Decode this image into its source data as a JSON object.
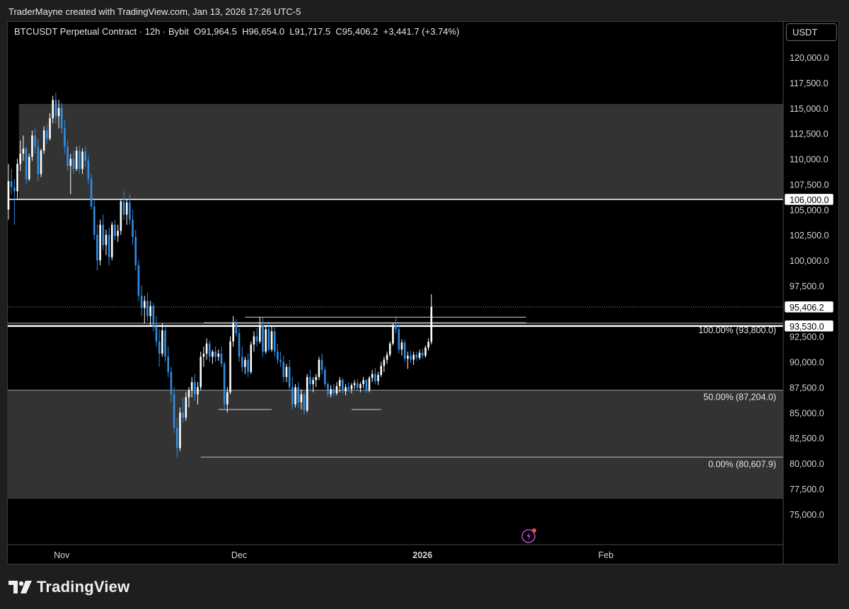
{
  "credit": "TraderMayne created with TradingView.com, Jan 13, 2026 17:26 UTC-5",
  "symbol": {
    "name": "BTCUSDT Perpetual Contract · 12h · Bybit",
    "open_label": "O",
    "open": "91,964.5",
    "high_label": "H",
    "high": "96,654.0",
    "low_label": "L",
    "low": "91,717.5",
    "close_label": "C",
    "close": "95,406.2",
    "change": "+3,441.7 (+3.74%)"
  },
  "currency": "USDT",
  "brand": "TradingView",
  "colors": {
    "background": "#000000",
    "zone": "#333333",
    "up_candle": "#ffffff",
    "down_candle": "#2f8de4",
    "line": "#ffffff"
  },
  "chart_data": {
    "type": "candlestick",
    "price_axis": {
      "ylim": [
        73000,
        122300
      ],
      "ticks": [
        120000,
        117500,
        115000,
        112500,
        110000,
        107500,
        105000,
        102500,
        100000,
        97500,
        92500,
        90000,
        87500,
        85000,
        82500,
        80000,
        77500,
        75000
      ],
      "tick_labels": [
        "120,000.0",
        "117,500.0",
        "115,000.0",
        "112,500.0",
        "110,000.0",
        "107,500.0",
        "105,000.0",
        "102,500.0",
        "100,000.0",
        "97,500.0",
        "92,500.0",
        "90,000.0",
        "87,500.0",
        "85,000.0",
        "82,500.0",
        "80,000.0",
        "77,500.0",
        "75,000.0"
      ]
    },
    "time_axis": {
      "labels": [
        {
          "text": "Nov",
          "bar": 18
        },
        {
          "text": "Dec",
          "bar": 78
        },
        {
          "text": "2026",
          "bar": 140,
          "bold": true
        },
        {
          "text": "Feb",
          "bar": 202
        }
      ]
    },
    "price_labels": [
      {
        "value": 106000,
        "text": "106,000.0"
      },
      {
        "value": 95406.2,
        "text": "95,406.2"
      },
      {
        "value": 93530,
        "text": "93,530.0"
      }
    ],
    "zones": [
      {
        "from": 106000,
        "to": 115400,
        "start_bar": 4
      },
      {
        "from": 76500,
        "to": 87200,
        "start_bar": 0
      }
    ],
    "horizontal_lines": [
      {
        "value": 106000,
        "label": null
      },
      {
        "value": 93530,
        "label": null
      }
    ],
    "fib_levels": [
      {
        "value": 93800,
        "text": "100.00% (93,800.0)"
      },
      {
        "value": 87204,
        "text": "50.00% (87,204.0)"
      },
      {
        "value": 80607.9,
        "text": "0.00% (80,607.9)"
      }
    ],
    "range_marks": [
      {
        "value": 94400,
        "from_bar": 80,
        "to_bar": 175
      },
      {
        "value": 93850,
        "from_bar": 66,
        "to_bar": 175
      },
      {
        "value": 85300,
        "from_bar": 71,
        "to_bar": 89
      },
      {
        "value": 85300,
        "from_bar": 116,
        "to_bar": 126
      }
    ],
    "last_price": 95406.2,
    "candles": [
      [
        105000,
        109500,
        104000,
        107800
      ],
      [
        107800,
        109000,
        106500,
        107200
      ],
      [
        107200,
        108000,
        103500,
        106800
      ],
      [
        106800,
        110000,
        106000,
        109500
      ],
      [
        109500,
        111800,
        108800,
        110500
      ],
      [
        110500,
        112300,
        109800,
        111000
      ],
      [
        111000,
        111200,
        107500,
        108000
      ],
      [
        108000,
        110500,
        107800,
        110200
      ],
      [
        110200,
        112800,
        109800,
        112300
      ],
      [
        112300,
        113000,
        110500,
        111200
      ],
      [
        111200,
        112000,
        107800,
        108500
      ],
      [
        108500,
        111000,
        108200,
        110800
      ],
      [
        110800,
        113200,
        110500,
        112800
      ],
      [
        112800,
        113400,
        111500,
        112000
      ],
      [
        112000,
        114500,
        111800,
        114000
      ],
      [
        114000,
        116200,
        113500,
        115800
      ],
      [
        115800,
        116500,
        113500,
        114200
      ],
      [
        114200,
        115800,
        113000,
        115000
      ],
      [
        115000,
        115500,
        112500,
        113000
      ],
      [
        113000,
        113800,
        110500,
        111200
      ],
      [
        111200,
        111800,
        108800,
        109300
      ],
      [
        109300,
        110500,
        106500,
        110000
      ],
      [
        110000,
        110800,
        108500,
        109000
      ],
      [
        109000,
        111200,
        108800,
        110800
      ],
      [
        110800,
        111300,
        108500,
        109000
      ],
      [
        109000,
        111000,
        108500,
        110700
      ],
      [
        110700,
        111200,
        109200,
        109800
      ],
      [
        109800,
        110300,
        107500,
        108000
      ],
      [
        108000,
        108500,
        105000,
        105300
      ],
      [
        105300,
        106000,
        102000,
        102500
      ],
      [
        102500,
        103500,
        99000,
        100000
      ],
      [
        100000,
        104000,
        99500,
        103500
      ],
      [
        103500,
        104500,
        101000,
        101500
      ],
      [
        101500,
        103000,
        100500,
        102500
      ],
      [
        102500,
        103200,
        99500,
        100300
      ],
      [
        100300,
        103800,
        100000,
        103500
      ],
      [
        103500,
        104000,
        102000,
        102400
      ],
      [
        102400,
        103500,
        101800,
        102900
      ],
      [
        102900,
        106000,
        102500,
        105800
      ],
      [
        105800,
        106800,
        104000,
        104500
      ],
      [
        104500,
        106000,
        103500,
        105700
      ],
      [
        105700,
        106500,
        103500,
        104000
      ],
      [
        104000,
        105000,
        101500,
        102300
      ],
      [
        102300,
        103000,
        99000,
        99500
      ],
      [
        99500,
        100000,
        96000,
        96500
      ],
      [
        96500,
        97500,
        94500,
        95300
      ],
      [
        95300,
        96500,
        93800,
        96000
      ],
      [
        96000,
        96800,
        94000,
        94500
      ],
      [
        94500,
        96000,
        93500,
        95500
      ],
      [
        95500,
        95800,
        93000,
        93500
      ],
      [
        93500,
        94500,
        91500,
        92000
      ],
      [
        92000,
        93200,
        89500,
        90800
      ],
      [
        90800,
        93800,
        90500,
        93100
      ],
      [
        93100,
        93500,
        90000,
        90500
      ],
      [
        90500,
        91500,
        88500,
        89000
      ],
      [
        89000,
        89500,
        86000,
        86800
      ],
      [
        86800,
        87500,
        83000,
        83500
      ],
      [
        83500,
        84500,
        80600,
        81500
      ],
      [
        81500,
        85500,
        81200,
        85000
      ],
      [
        85000,
        86500,
        84000,
        84500
      ],
      [
        84500,
        87000,
        84200,
        86500
      ],
      [
        86500,
        87500,
        85500,
        87200
      ],
      [
        87200,
        88500,
        86500,
        88000
      ],
      [
        88000,
        88800,
        86200,
        86800
      ],
      [
        86800,
        88000,
        85800,
        87500
      ],
      [
        87500,
        91000,
        87200,
        90500
      ],
      [
        90500,
        91500,
        89500,
        90800
      ],
      [
        90800,
        92300,
        90200,
        91800
      ],
      [
        91800,
        92100,
        90000,
        90500
      ],
      [
        90500,
        91200,
        89800,
        91000
      ],
      [
        91000,
        91500,
        90000,
        90500
      ],
      [
        90500,
        91200,
        90100,
        90800
      ],
      [
        90800,
        91500,
        89500,
        89800
      ],
      [
        89800,
        90000,
        85300,
        85800
      ],
      [
        85800,
        87500,
        85000,
        87000
      ],
      [
        87000,
        92500,
        86800,
        92000
      ],
      [
        92000,
        94500,
        91500,
        93800
      ],
      [
        93800,
        94200,
        92500,
        92800
      ],
      [
        92800,
        93300,
        90000,
        90500
      ],
      [
        90500,
        91500,
        89000,
        89500
      ],
      [
        89500,
        90500,
        88800,
        90200
      ],
      [
        90200,
        90800,
        88500,
        89000
      ],
      [
        89000,
        92000,
        88800,
        91700
      ],
      [
        91700,
        93000,
        91000,
        92500
      ],
      [
        92500,
        93300,
        91500,
        92000
      ],
      [
        92000,
        94400,
        91800,
        93600
      ],
      [
        93600,
        94400,
        90500,
        91000
      ],
      [
        91000,
        93600,
        90800,
        93200
      ],
      [
        93200,
        93800,
        91000,
        91200
      ],
      [
        91200,
        93500,
        91000,
        93000
      ],
      [
        93000,
        93400,
        90500,
        91000
      ],
      [
        91000,
        91800,
        89800,
        90200
      ],
      [
        90200,
        91000,
        89500,
        90000
      ],
      [
        90000,
        90600,
        88000,
        88500
      ],
      [
        88500,
        89800,
        88000,
        89500
      ],
      [
        89500,
        90200,
        87200,
        87500
      ],
      [
        87500,
        88500,
        85300,
        85800
      ],
      [
        85800,
        87800,
        85500,
        87500
      ],
      [
        87500,
        88000,
        85500,
        86000
      ],
      [
        86000,
        87300,
        85300,
        86800
      ],
      [
        86800,
        87000,
        84800,
        85200
      ],
      [
        85200,
        88800,
        85000,
        88500
      ],
      [
        88500,
        89200,
        87200,
        87800
      ],
      [
        87800,
        88500,
        87000,
        88200
      ],
      [
        88200,
        88800,
        87500,
        88500
      ],
      [
        88500,
        90500,
        88200,
        90200
      ],
      [
        90200,
        90800,
        88800,
        89200
      ],
      [
        89200,
        89500,
        87500,
        87800
      ],
      [
        87800,
        88000,
        86500,
        86800
      ],
      [
        86800,
        87700,
        86500,
        87300
      ],
      [
        87300,
        87800,
        86600,
        86900
      ],
      [
        86900,
        88000,
        86700,
        87600
      ],
      [
        87600,
        88500,
        87000,
        88200
      ],
      [
        88200,
        88400,
        86800,
        87100
      ],
      [
        87100,
        87800,
        86700,
        87500
      ],
      [
        87500,
        88000,
        87000,
        87300
      ],
      [
        87300,
        87900,
        86900,
        87700
      ],
      [
        87700,
        88200,
        87300,
        87900
      ],
      [
        87900,
        88300,
        87100,
        87400
      ],
      [
        87400,
        88000,
        87000,
        87800
      ],
      [
        87800,
        88500,
        87400,
        88200
      ],
      [
        88200,
        88300,
        86900,
        87200
      ],
      [
        87200,
        88600,
        87000,
        88400
      ],
      [
        88400,
        89200,
        88000,
        88800
      ],
      [
        88800,
        89400,
        87800,
        88100
      ],
      [
        88100,
        89000,
        87700,
        88700
      ],
      [
        88700,
        90000,
        88500,
        89600
      ],
      [
        89600,
        90500,
        89000,
        90200
      ],
      [
        90200,
        91000,
        89800,
        90700
      ],
      [
        90700,
        92000,
        90500,
        91800
      ],
      [
        91800,
        93800,
        91600,
        93600
      ],
      [
        93600,
        94500,
        92800,
        93200
      ],
      [
        93200,
        93600,
        90800,
        91200
      ],
      [
        91200,
        92200,
        90600,
        91900
      ],
      [
        91900,
        92200,
        90000,
        90300
      ],
      [
        90300,
        91000,
        89300,
        90600
      ],
      [
        90600,
        91100,
        89900,
        90200
      ],
      [
        90200,
        91000,
        89700,
        90700
      ],
      [
        90700,
        91000,
        90100,
        90400
      ],
      [
        90400,
        91200,
        90200,
        90900
      ],
      [
        90900,
        91300,
        90300,
        90600
      ],
      [
        90600,
        91600,
        90400,
        91400
      ],
      [
        91400,
        92300,
        91100,
        91964.5
      ],
      [
        91964.5,
        96654,
        91717.5,
        95406.2
      ]
    ]
  }
}
